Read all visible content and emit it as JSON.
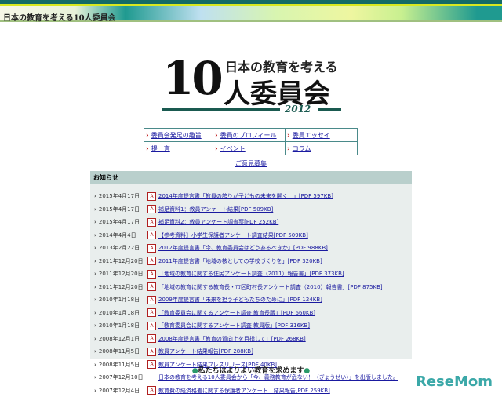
{
  "header": {
    "site_title": "日本の教育を考える10人委員会"
  },
  "logo": {
    "line1": "日本の教育を考える",
    "num": "10",
    "line2": "人委員会",
    "year": "2012"
  },
  "nav": [
    [
      "委員会発足の趣旨",
      "委員のプロフィール",
      "委員エッセイ"
    ],
    [
      "提　言",
      "イベント",
      "コラム"
    ]
  ],
  "opinion_link": "ご意見募集",
  "news": {
    "title": "お知らせ",
    "items": [
      {
        "date": "2015年4月17日",
        "text": "2014年度提言書「教員の誇りが子どもの未来を開く！」[PDF 597KB]",
        "pdf": true
      },
      {
        "date": "2015年4月17日",
        "text": "補足資料1：教員アンケート結果[PDF 509KB]",
        "pdf": true
      },
      {
        "date": "2015年4月17日",
        "text": "補足資料2：教員アンケート調査票[PDF 252KB]",
        "pdf": true
      },
      {
        "date": "2014年4月4日",
        "text": "【参考資料】小学生保護者アンケート調査結果[PDF 509KB]",
        "pdf": true
      },
      {
        "date": "2013年2月22日",
        "text": "2012年度提言書「今、教育委員会はどうあるべきか」[PDF 988KB]",
        "pdf": true
      },
      {
        "date": "2011年12月20日",
        "text": "2011年度提言書「地域の核としての学校づくりを」[PDF 320KB]",
        "pdf": true
      },
      {
        "date": "2011年12月20日",
        "text": "「地域の教育に関する住民アンケート調査（2011）報告書」[PDF 373KB]",
        "pdf": true
      },
      {
        "date": "2011年12月20日",
        "text": "「地域の教育に関する教育長・市区町村長アンケート調査（2010）報告書」[PDF 875KB]",
        "pdf": true
      },
      {
        "date": "2010年1月18日",
        "text": "2009年度提言書「未来を担う子どもたちのために」[PDF 124KB]",
        "pdf": true
      },
      {
        "date": "2010年1月18日",
        "text": "「教育委員会に関するアンケート調査 教育長版」[PDF 660KB]",
        "pdf": true
      },
      {
        "date": "2010年1月18日",
        "text": "「教育委員会に関するアンケート調査 教員版」[PDF 316KB]",
        "pdf": true
      },
      {
        "date": "2008年12月1日",
        "text": "2008年度提言書「教育の質向上を目指して」[PDF 268KB]",
        "pdf": true
      },
      {
        "date": "2008年11月5日",
        "text": "教員アンケート結果報告[PDF 288KB]",
        "pdf": true
      },
      {
        "date": "2008年11月5日",
        "text": "教員アンケート結果プレスリリース[PDF 40KB]",
        "pdf": true
      },
      {
        "date": "2007年12月10日",
        "text": "日本の教育を考える10人委員会から「今、義務教育が危ない！（ぎょうせい）」を出版しました。",
        "pdf": false
      },
      {
        "date": "2007年12月4日",
        "text": "教育費の経済格差に関する保護者アンケート　結果報告[PDF 259KB]",
        "pdf": true
      }
    ]
  },
  "footer_msg": "私たちはよりよい教育を求めます",
  "watermark": "ReseMom"
}
